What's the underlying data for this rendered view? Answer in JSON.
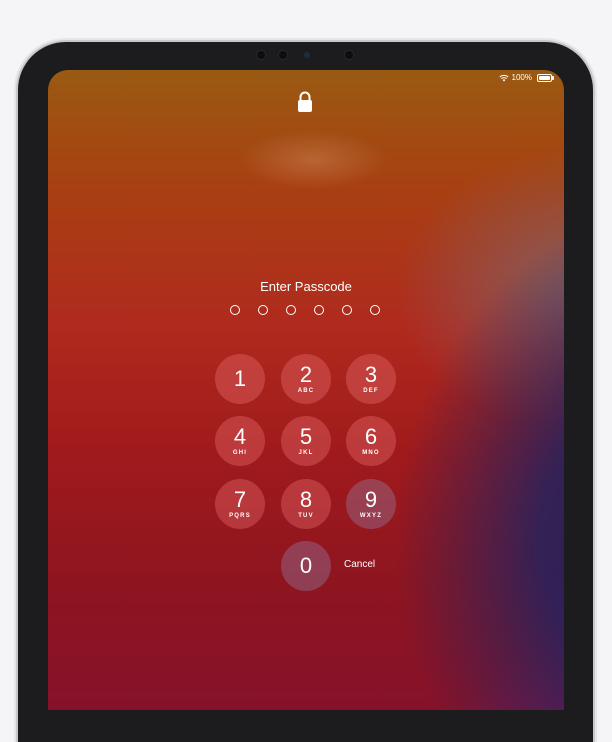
{
  "status_bar": {
    "battery_text": "100%"
  },
  "lock_screen": {
    "prompt": "Enter Passcode",
    "passcode_slots": 6,
    "keys": [
      {
        "digit": "1",
        "letters": ""
      },
      {
        "digit": "2",
        "letters": "ABC"
      },
      {
        "digit": "3",
        "letters": "DEF"
      },
      {
        "digit": "4",
        "letters": "GHI"
      },
      {
        "digit": "5",
        "letters": "JKL"
      },
      {
        "digit": "6",
        "letters": "MNO"
      },
      {
        "digit": "7",
        "letters": "PQRS"
      },
      {
        "digit": "8",
        "letters": "TUV"
      },
      {
        "digit": "9",
        "letters": "WXYZ"
      },
      {
        "digit": "0",
        "letters": ""
      }
    ],
    "cancel_label": "Cancel"
  },
  "icons": {
    "lock": "lock-icon",
    "wifi": "wifi-icon",
    "battery": "battery-icon"
  }
}
